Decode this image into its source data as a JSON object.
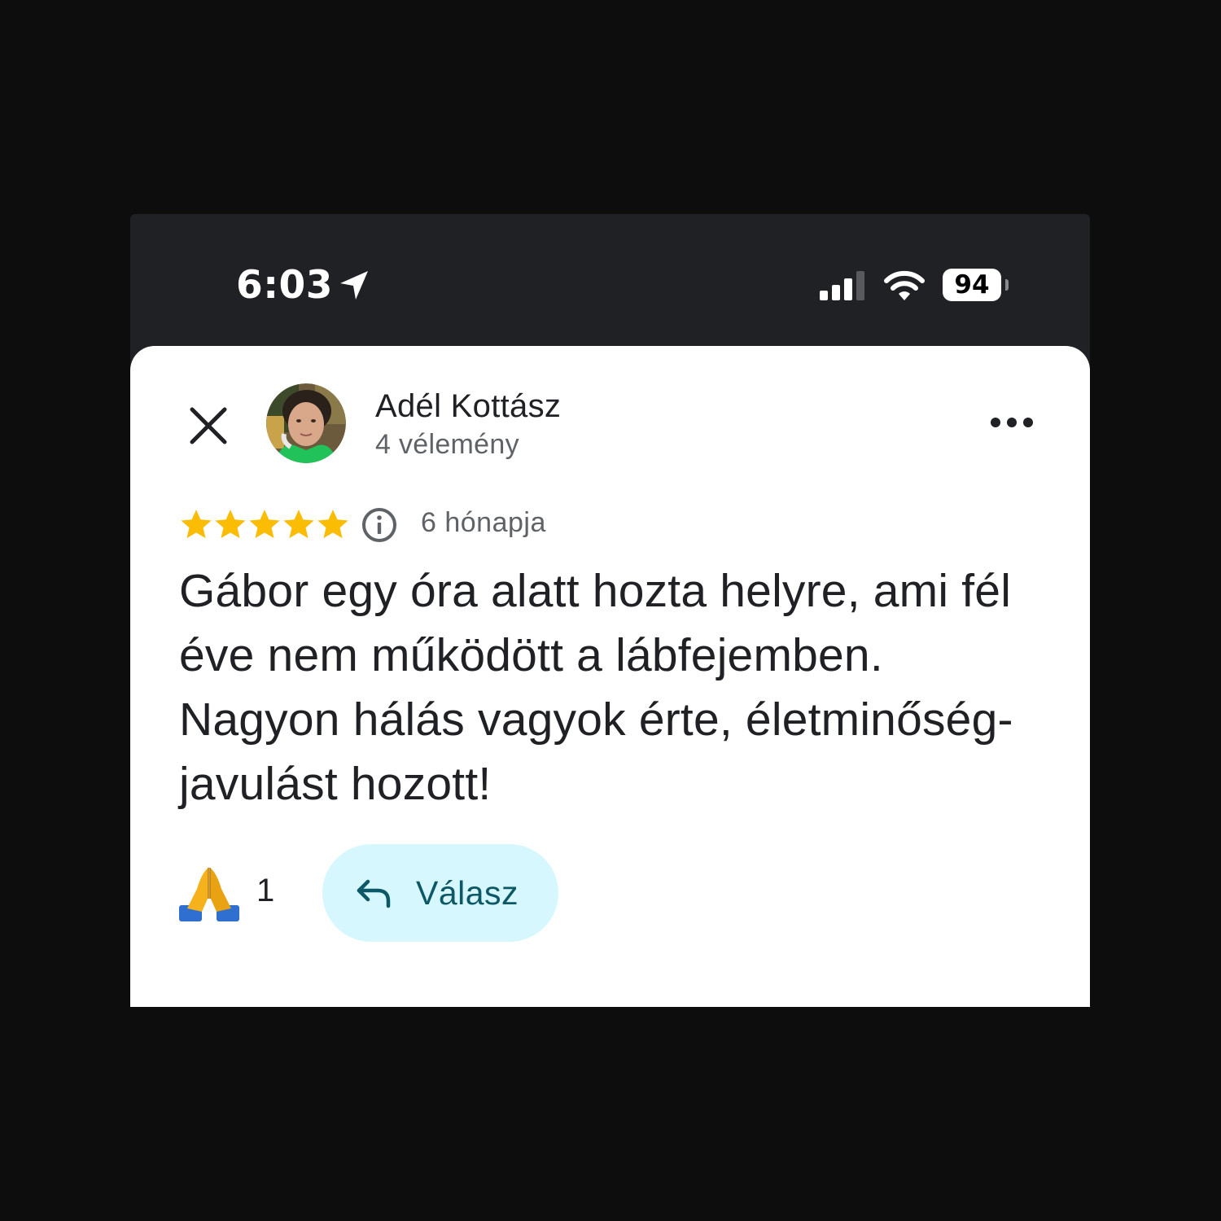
{
  "status_bar": {
    "time": "6:03",
    "battery": "94"
  },
  "review": {
    "author_name": "Adél Kottász",
    "review_count": "4 vélemény",
    "rating": 5,
    "rating_max": 5,
    "age": "6 hónapja",
    "text": "Gábor egy óra alatt hozta helyre, ami fél éve nem működött a lábfejemben. Nagyon hálás vagyok érte, életminőség-javulást hozott!",
    "reaction_count": "1",
    "reply_label": "Válasz"
  },
  "colors": {
    "page_background": "#0d0d0d",
    "status_bar_background": "#202125",
    "star": "#fbbc04",
    "reply_button_background": "#d6f7fd",
    "reply_text": "#0c5866"
  },
  "icons": {
    "location": "location-arrow-icon",
    "signal": "cellular-signal-icon",
    "wifi": "wifi-icon",
    "close": "close-icon",
    "more": "more-horizontal-icon",
    "star": "star-icon",
    "info": "info-icon",
    "reaction": "folded-hands-emoji-icon",
    "reply": "reply-arrow-icon"
  }
}
